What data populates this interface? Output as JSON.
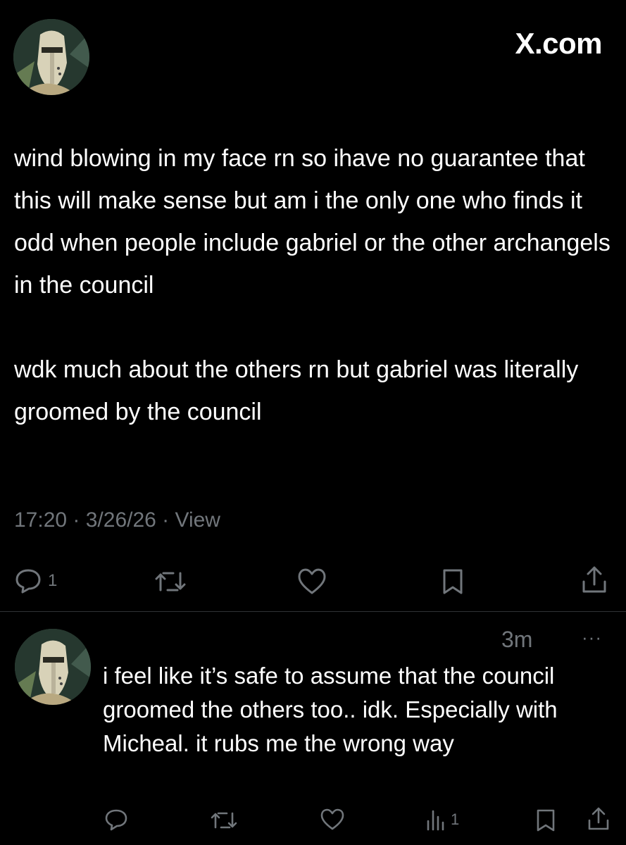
{
  "header": {
    "brand": "X.com",
    "avatar_icon": "armored-helmet-avatar"
  },
  "tweet": {
    "paragraphs": [
      "wind blowing in my face rn so ihave no guarantee that this will make sense but am i the only one who finds it odd when people include gabriel or the other archangels in the council",
      "wdk much about the others rn but gabriel was literally groomed by the council"
    ],
    "meta": "17:20 · 3/26/26 · View",
    "actions": {
      "reply_icon": "reply-icon",
      "reply_count": "1",
      "retweet_icon": "retweet-icon",
      "like_icon": "heart-icon",
      "bookmark_icon": "bookmark-icon",
      "share_icon": "share-icon"
    }
  },
  "reply": {
    "time": "3m",
    "more": "···",
    "text": "i feel like it’s safe to assume that the council groomed the others too.. idk. Especially with Micheal. it rubs me the wrong way",
    "actions": {
      "reply_icon": "reply-icon",
      "retweet_icon": "retweet-icon",
      "like_icon": "heart-icon",
      "views_icon": "views-bar-icon",
      "views_count": "1",
      "bookmark_icon": "bookmark-icon",
      "share_icon": "share-icon"
    }
  },
  "colors": {
    "background": "#000000",
    "text": "#ffffff",
    "muted": "#71767b",
    "divider": "#2f3336"
  }
}
